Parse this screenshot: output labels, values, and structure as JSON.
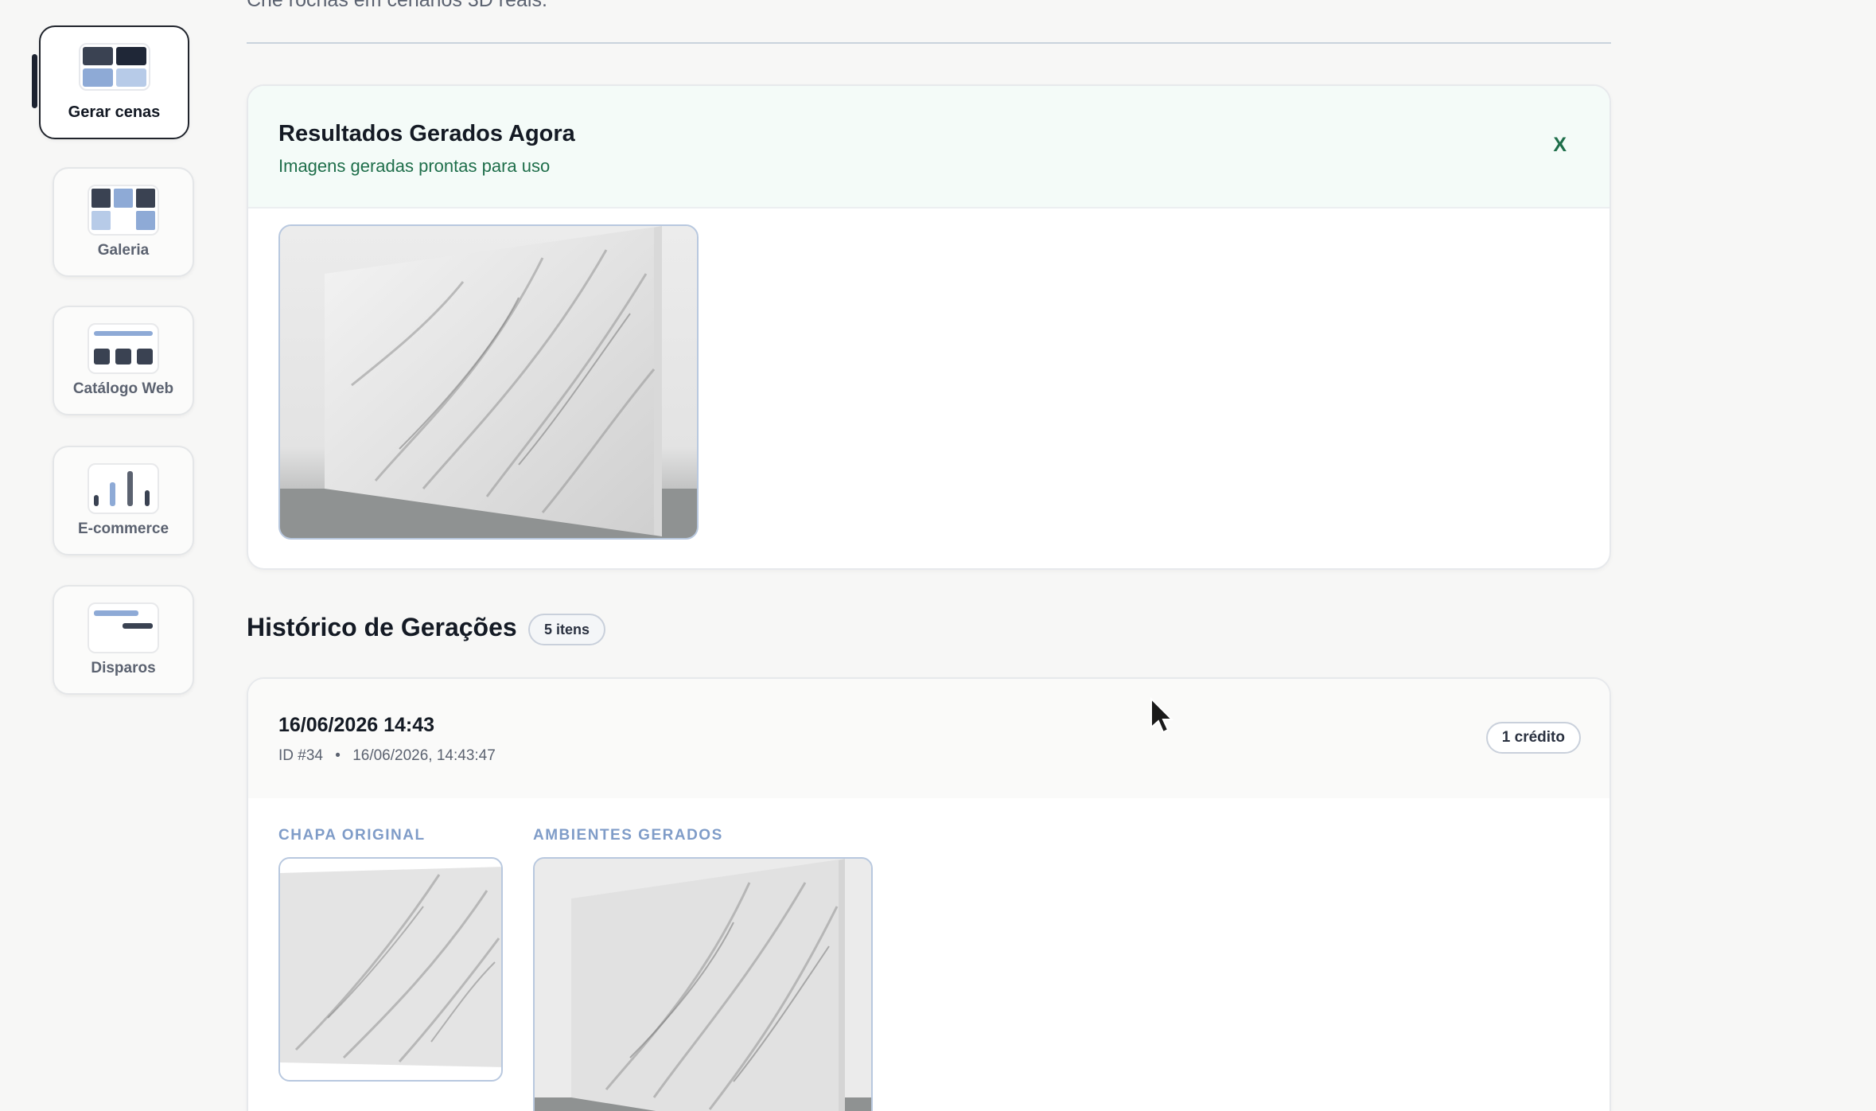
{
  "sidebar": {
    "items": [
      {
        "label": "Gerar cenas",
        "active": true,
        "icon": "grid-blocks-icon"
      },
      {
        "label": "Galeria",
        "active": false,
        "icon": "gallery-grid-icon"
      },
      {
        "label": "Catálogo Web",
        "active": false,
        "icon": "catalog-web-icon"
      },
      {
        "label": "E-commerce",
        "active": false,
        "icon": "bar-chart-icon"
      },
      {
        "label": "Disparos",
        "active": false,
        "icon": "message-lines-icon"
      }
    ]
  },
  "main": {
    "intro_text": "Crie rochas em cenários 3D reais.",
    "results": {
      "title": "Resultados Gerados Agora",
      "subtitle": "Imagens geradas prontas para uso",
      "close_label": "X"
    },
    "history": {
      "title": "Histórico de Gerações",
      "count_badge": "5 itens",
      "entries": [
        {
          "date": "16/06/2026 14:43",
          "id": "ID #34",
          "timestamp": "16/06/2026, 14:43:47",
          "credits": "1 crédito",
          "original_label": "CHAPA ORIGINAL",
          "generated_label": "AMBIENTES GERADOS"
        }
      ]
    }
  },
  "colors": {
    "accent_green": "#1e6e4a",
    "label_blue": "#7f9cc8",
    "dark": "#1c2230",
    "icon_blue": "#8eaad6",
    "icon_light_blue": "#b7cbe8"
  }
}
